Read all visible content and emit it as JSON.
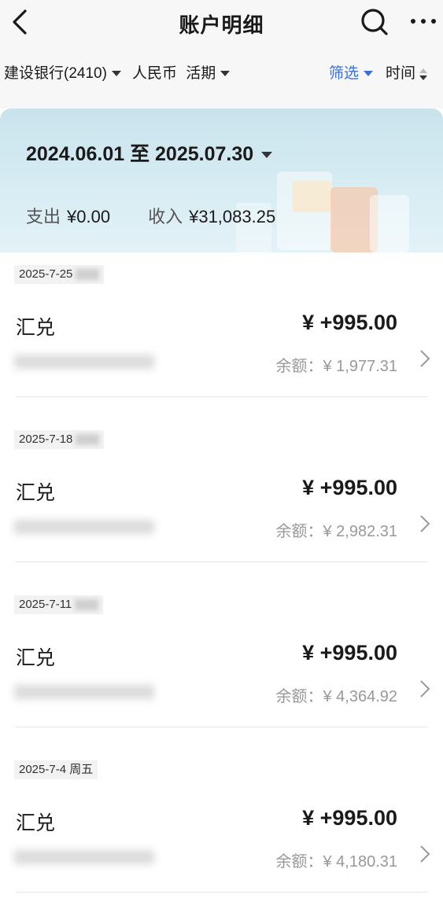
{
  "header": {
    "title": "账户明细"
  },
  "filters": {
    "account": "建设银行(2410)",
    "currency": "人民币",
    "type": "活期",
    "filter": "筛选",
    "sort": "时间"
  },
  "summary": {
    "date_range": "2024.06.01 至 2025.07.30",
    "expense_label": "支出",
    "expense": "¥0.00",
    "income_label": "收入",
    "income": "¥31,083.25"
  },
  "transactions": [
    {
      "date": "2025-7-25",
      "weekday": "",
      "name": "汇兑",
      "amount": "¥ +995.00",
      "balance": "余额：¥ 1,977.31"
    },
    {
      "date": "2025-7-18",
      "weekday": "",
      "name": "汇兑",
      "amount": "¥ +995.00",
      "balance": "余额：¥ 2,982.31"
    },
    {
      "date": "2025-7-11",
      "weekday": "",
      "name": "汇兑",
      "amount": "¥ +995.00",
      "balance": "余额：¥ 4,364.92"
    },
    {
      "date": "2025-7-4",
      "weekday": "周五",
      "name": "汇兑",
      "amount": "¥ +995.00",
      "balance": "余额：¥ 4,180.31"
    }
  ],
  "icons": [
    "back-arrow-icon",
    "search-icon",
    "more-icon",
    "chevron-right-icon"
  ]
}
